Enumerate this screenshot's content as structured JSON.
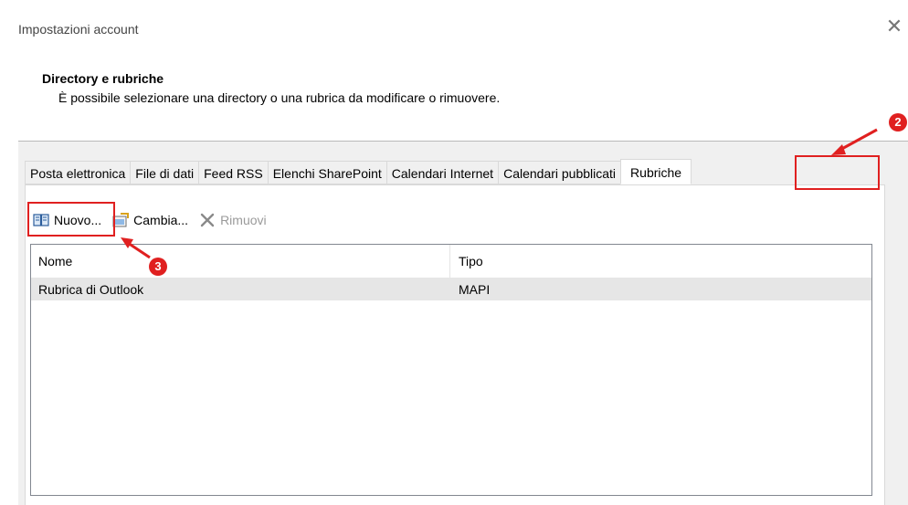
{
  "dialog": {
    "title": "Impostazioni account",
    "close_glyph": "✕"
  },
  "header": {
    "title": "Directory e rubriche",
    "description": "È possibile selezionare una directory o una rubrica da modificare o rimuovere."
  },
  "tabs": [
    {
      "label": "Posta elettronica"
    },
    {
      "label": "File di dati"
    },
    {
      "label": "Feed RSS"
    },
    {
      "label": "Elenchi SharePoint"
    },
    {
      "label": "Calendari Internet"
    },
    {
      "label": "Calendari pubblicati"
    },
    {
      "label": "Rubriche"
    }
  ],
  "toolbar": {
    "new_label": "Nuovo...",
    "change_label": "Cambia...",
    "remove_label": "Rimuovi",
    "icons": [
      "address-book-icon",
      "change-icon",
      "remove-x-icon"
    ]
  },
  "list": {
    "columns": [
      "Nome",
      "Tipo"
    ],
    "rows": [
      {
        "name": "Rubrica di Outlook",
        "type": "MAPI"
      }
    ]
  },
  "annotations": {
    "step2": "2",
    "step3": "3",
    "color": "#e02020"
  },
  "colors": {
    "dialog_bg": "#ffffff",
    "body_bg": "#f0f0f0",
    "selected_row": "#e6e6e6",
    "annotation_red": "#e02020"
  }
}
